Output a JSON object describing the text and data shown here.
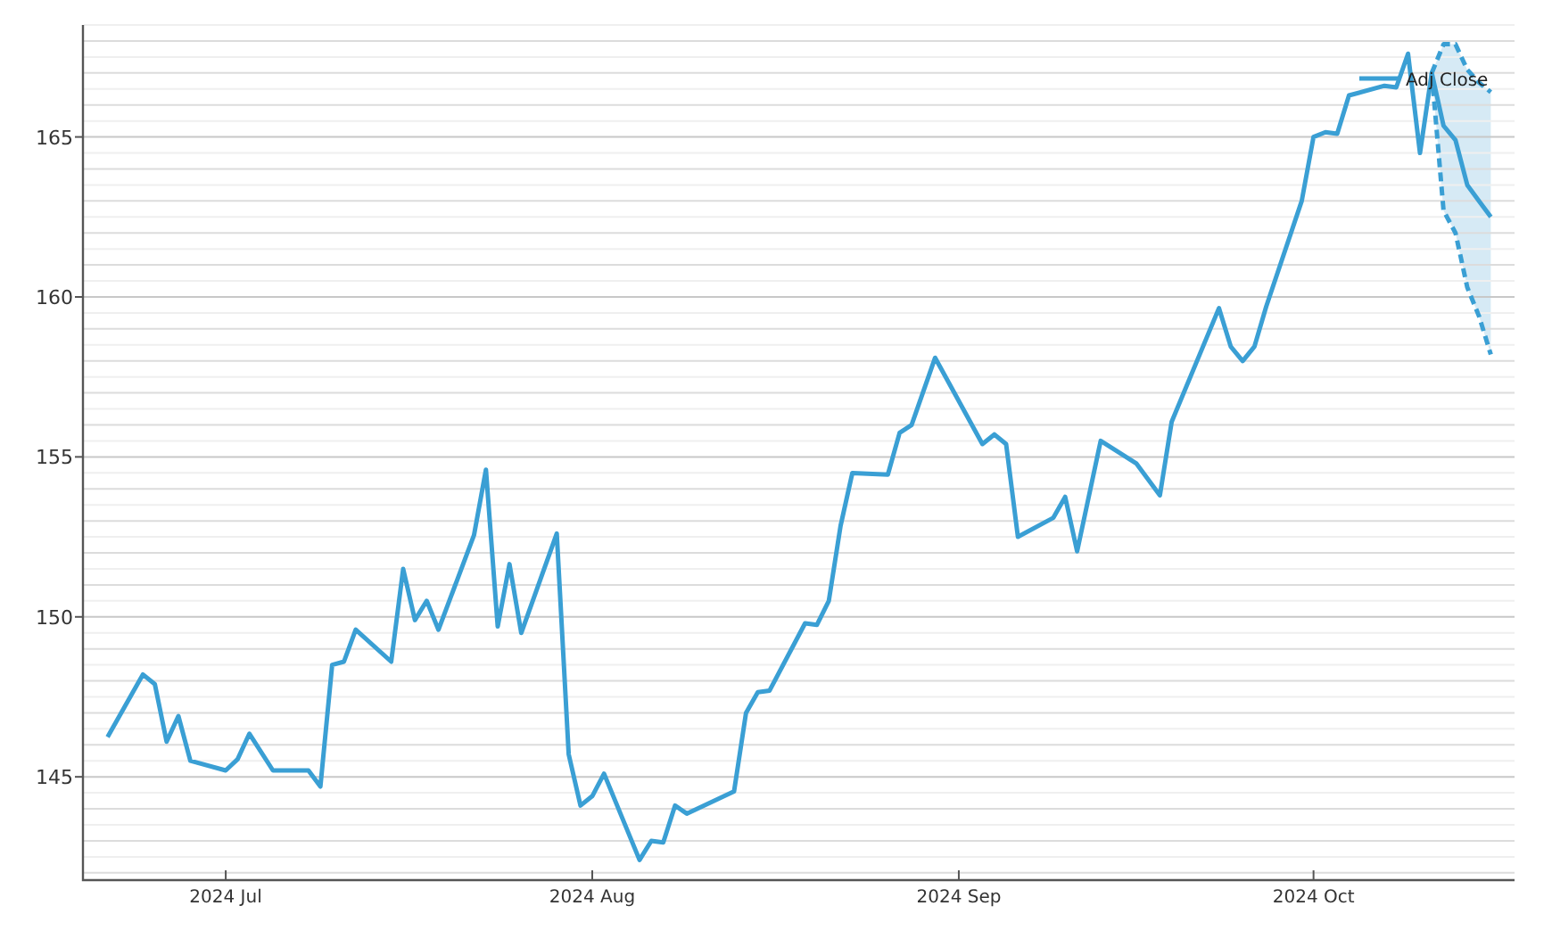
{
  "chart": {
    "chart_data": {
      "type": "line",
      "x": [
        "2024-06-21",
        "2024-06-24",
        "2024-06-25",
        "2024-06-26",
        "2024-06-27",
        "2024-06-28",
        "2024-07-01",
        "2024-07-02",
        "2024-07-03",
        "2024-07-05",
        "2024-07-08",
        "2024-07-09",
        "2024-07-10",
        "2024-07-11",
        "2024-07-12",
        "2024-07-15",
        "2024-07-16",
        "2024-07-17",
        "2024-07-18",
        "2024-07-19",
        "2024-07-22",
        "2024-07-23",
        "2024-07-24",
        "2024-07-25",
        "2024-07-26",
        "2024-07-29",
        "2024-07-30",
        "2024-07-31",
        "2024-08-01",
        "2024-08-02",
        "2024-08-05",
        "2024-08-06",
        "2024-08-07",
        "2024-08-08",
        "2024-08-09",
        "2024-08-13",
        "2024-08-14",
        "2024-08-15",
        "2024-08-16",
        "2024-08-19",
        "2024-08-20",
        "2024-08-21",
        "2024-08-22",
        "2024-08-23",
        "2024-08-26",
        "2024-08-27",
        "2024-08-28",
        "2024-08-30",
        "2024-09-03",
        "2024-09-04",
        "2024-09-05",
        "2024-09-06",
        "2024-09-09",
        "2024-09-10",
        "2024-09-11",
        "2024-09-13",
        "2024-09-16",
        "2024-09-18",
        "2024-09-19",
        "2024-09-23",
        "2024-09-24",
        "2024-09-25",
        "2024-09-26",
        "2024-09-27",
        "2024-09-30",
        "2024-10-01",
        "2024-10-02",
        "2024-10-03",
        "2024-10-04",
        "2024-10-07",
        "2024-10-08",
        "2024-10-09",
        "2024-10-10",
        "2024-10-11",
        "2024-10-12",
        "2024-10-13",
        "2024-10-14",
        "2024-10-15",
        "2024-10-16"
      ],
      "series": [
        {
          "name": "Adj Close",
          "line_style": "solid",
          "color": "#3a9fd4",
          "values": [
            146.25,
            148.2,
            147.9,
            146.1,
            146.9,
            145.5,
            145.2,
            145.55,
            146.35,
            145.2,
            145.2,
            144.7,
            148.5,
            148.6,
            149.6,
            148.6,
            151.5,
            149.9,
            150.5,
            149.6,
            152.55,
            154.6,
            149.7,
            151.65,
            149.5,
            152.6,
            145.7,
            144.1,
            144.4,
            145.1,
            142.4,
            143.0,
            142.95,
            144.1,
            143.85,
            144.55,
            147.0,
            147.65,
            147.7,
            149.8,
            149.75,
            150.5,
            152.85,
            154.5,
            154.45,
            155.75,
            156.0,
            158.1,
            155.4,
            155.7,
            155.4,
            152.5,
            153.1,
            153.75,
            152.05,
            155.5,
            154.8,
            153.8,
            156.1,
            159.65,
            158.45,
            158.0,
            158.45,
            159.7,
            163.0,
            165.0,
            165.15,
            165.1,
            166.3,
            166.6,
            166.55,
            167.6,
            164.5,
            167.0,
            165.35,
            164.9,
            163.5,
            163.0,
            162.5
          ]
        },
        {
          "line_style": "dashed",
          "color": "#3a9fd4",
          "values": [
            null,
            null,
            null,
            null,
            null,
            null,
            null,
            null,
            null,
            null,
            null,
            null,
            null,
            null,
            null,
            null,
            null,
            null,
            null,
            null,
            null,
            null,
            null,
            null,
            null,
            null,
            null,
            null,
            null,
            null,
            null,
            null,
            null,
            null,
            null,
            null,
            null,
            null,
            null,
            null,
            null,
            null,
            null,
            null,
            null,
            null,
            null,
            null,
            null,
            null,
            null,
            null,
            null,
            null,
            null,
            null,
            null,
            null,
            null,
            null,
            null,
            null,
            null,
            null,
            null,
            null,
            null,
            null,
            null,
            null,
            null,
            null,
            null,
            167.0,
            167.9,
            167.9,
            167.1,
            166.7,
            166.4
          ]
        },
        {
          "line_style": "dashed",
          "color": "#3a9fd4",
          "values": [
            null,
            null,
            null,
            null,
            null,
            null,
            null,
            null,
            null,
            null,
            null,
            null,
            null,
            null,
            null,
            null,
            null,
            null,
            null,
            null,
            null,
            null,
            null,
            null,
            null,
            null,
            null,
            null,
            null,
            null,
            null,
            null,
            null,
            null,
            null,
            null,
            null,
            null,
            null,
            null,
            null,
            null,
            null,
            null,
            null,
            null,
            null,
            null,
            null,
            null,
            null,
            null,
            null,
            null,
            null,
            null,
            null,
            null,
            null,
            null,
            null,
            null,
            null,
            null,
            null,
            null,
            null,
            null,
            null,
            null,
            null,
            null,
            null,
            167.0,
            162.7,
            162.0,
            160.3,
            159.4,
            158.2
          ]
        }
      ],
      "grid": true,
      "xlim": [
        "2024-06-19",
        "2024-10-18"
      ],
      "ylim": [
        141.8,
        168.5
      ],
      "xticks": [
        {
          "value": "2024-07-01",
          "label": "2024 Jul"
        },
        {
          "value": "2024-08-01",
          "label": "2024 Aug"
        },
        {
          "value": "2024-09-01",
          "label": "2024 Sep"
        },
        {
          "value": "2024-10-01",
          "label": "2024 Oct"
        }
      ],
      "yticks": [
        145,
        150,
        155,
        160,
        165
      ]
    }
  }
}
